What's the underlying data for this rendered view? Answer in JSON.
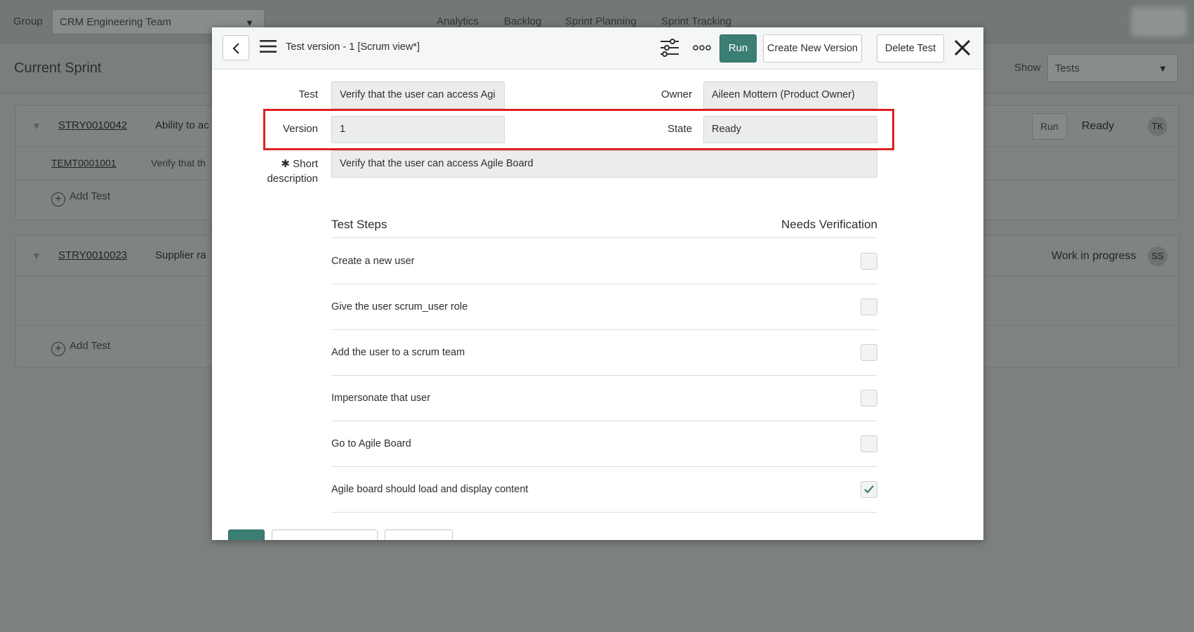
{
  "app": {
    "group_label": "Group",
    "group_value": "CRM Engineering Team",
    "nav_tabs": [
      "Analytics",
      "Backlog",
      "Sprint Planning",
      "Sprint Tracking"
    ],
    "sprint_title": "Current Sprint",
    "show_label": "Show",
    "show_value": "Tests",
    "stories": [
      {
        "id": "STRY0010042",
        "name": "Ability to ac",
        "run_label": "Run",
        "state": "Ready",
        "assignee": "TK",
        "tests": [
          {
            "id": "TEMT0001001",
            "name": "Verify that th"
          }
        ],
        "add_test_label": "Add Test"
      },
      {
        "id": "STRY0010023",
        "name": "Supplier ra",
        "state": "Work in progress",
        "assignee": "SS",
        "add_test_label": "Add Test"
      }
    ]
  },
  "modal": {
    "title": "Test version - 1 [Scrum view*]",
    "run_label": "Run",
    "create_version_label": "Create New Version",
    "delete_label": "Delete Test",
    "fields": {
      "test_label": "Test",
      "test_value": "Verify that the user can access Agi",
      "owner_label": "Owner",
      "owner_value": "Aileen Mottern (Product Owner)",
      "version_label": "Version",
      "version_value": "1",
      "state_label": "State",
      "state_value": "Ready",
      "short_desc_required": "✱",
      "short_desc_label_1": "Short",
      "short_desc_label_2": "description",
      "short_desc_value": "Verify that the user can access Agile Board"
    },
    "steps_title": "Test Steps",
    "needs_verification_title": "Needs Verification",
    "steps": [
      {
        "text": "Create a new user",
        "checked": false
      },
      {
        "text": "Give the user scrum_user role",
        "checked": false
      },
      {
        "text": "Add the user to a scrum team",
        "checked": false
      },
      {
        "text": "Impersonate that user",
        "checked": false
      },
      {
        "text": "Go to Agile Board",
        "checked": false
      },
      {
        "text": "Agile board should load and display content",
        "checked": true
      }
    ]
  },
  "colors": {
    "accent": "#3b7e74",
    "highlight": "#e02020"
  }
}
